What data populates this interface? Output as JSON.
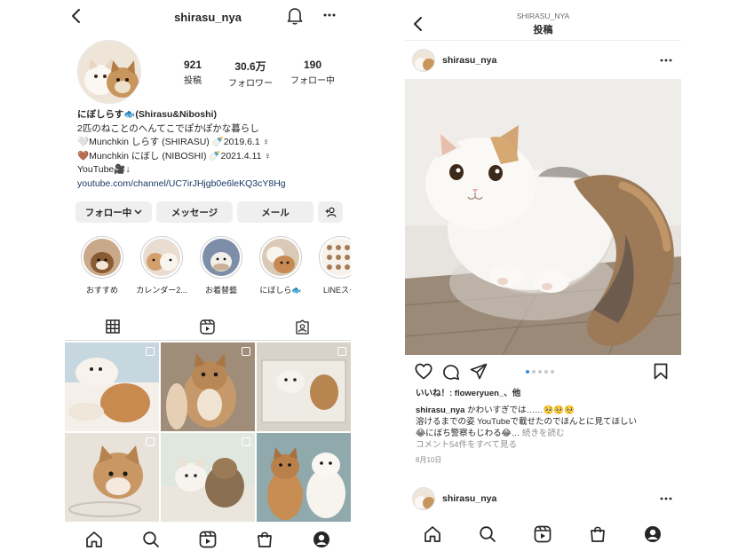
{
  "profile": {
    "username": "shirasu_nya",
    "stats": [
      {
        "num": "921",
        "label": "投稿"
      },
      {
        "num": "30.6万",
        "label": "フォロワー"
      },
      {
        "num": "190",
        "label": "フォロー中"
      }
    ],
    "bio": {
      "name": "にぼしらす🐟(Shirasu&Niboshi)",
      "line1": "2匹のねことのへんてこでぽかぽかな暮らし",
      "line2": "🤍Munchkin しらす (SHIRASU) 🍼2019.6.1 ♀",
      "line3": "🤎Munchkin にぼし (NIBOSHI) 🍼2021.4.11 ♀",
      "line4": "YouTube🎥↓",
      "link": "youtube.com/channel/UC7irJHjgb0e6leKQ3cY8Hg"
    },
    "buttons": {
      "following": "フォロー中",
      "message": "メッセージ",
      "email": "メール"
    },
    "highlights": [
      {
        "label": "おすすめ"
      },
      {
        "label": "カレンダー2..."
      },
      {
        "label": "お着替藝"
      },
      {
        "label": "にぼしら🐟"
      },
      {
        "label": "LINEスタ"
      }
    ]
  },
  "post": {
    "header_sub": "SHIRASU_NYA",
    "header_title": "投稿",
    "username": "shirasu_nya",
    "likes": "いいね！: floweryuen_、他",
    "caption_user": "shirasu_nya",
    "caption_text1": " かわいすぎでは……🥺🥺🥺",
    "caption_text2": "溶けるまでの姿 YouTubeで載せたのでほんとに見てほしい",
    "caption_text3": "😂にぼち警察もじわる😂… ",
    "more": "続きを読む",
    "comments": "コメント54件をすべて見る",
    "date": "8月10日",
    "next_username": "shirasu_nya",
    "carousel": {
      "count": 5,
      "active": 0
    }
  },
  "colors": {
    "text": "#262626",
    "muted": "#8e8e8e",
    "link": "#1b3a66",
    "button_bg": "#efefef",
    "carousel_active": "#3b8fd9"
  },
  "icons": [
    "back-icon",
    "bell-icon",
    "more-icon",
    "grid-icon",
    "reels-icon",
    "tagged-icon",
    "home-icon",
    "search-icon",
    "shop-icon",
    "profile-icon",
    "heart-icon",
    "comment-icon",
    "share-icon",
    "bookmark-icon",
    "add-person-icon",
    "chevron-down-icon"
  ]
}
